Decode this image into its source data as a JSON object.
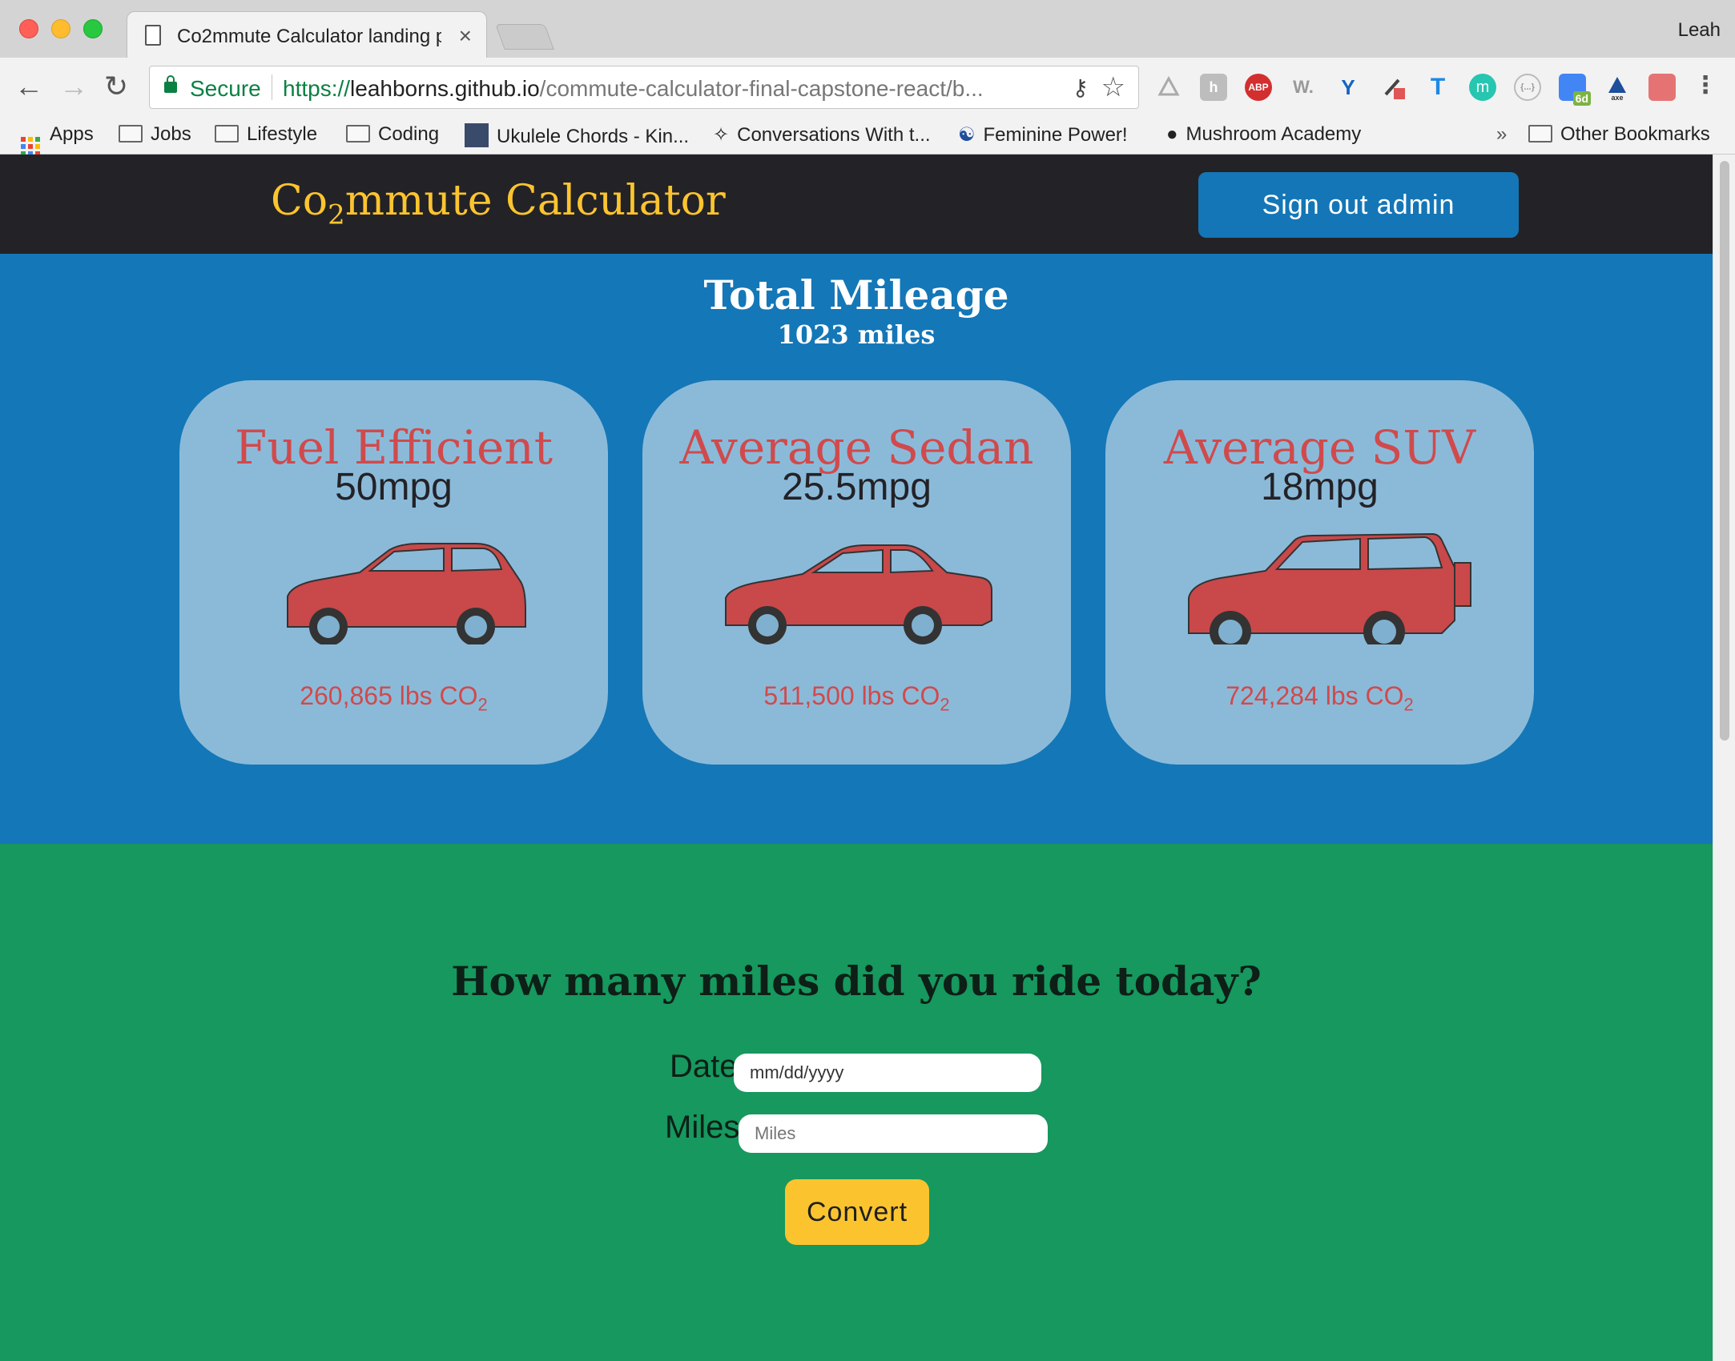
{
  "browser": {
    "tab_title": "Co2mmute Calculator landing p",
    "tab_close": "×",
    "profile_name": "Leah",
    "secure_label": "Secure",
    "url_protocol": "https://",
    "url_host": "leahborns.github.io",
    "url_path": "/commute-calculator-final-capstone-react/b...",
    "icons": {
      "back": "back-arrow-icon",
      "forward": "forward-arrow-icon",
      "reload": "reload-icon",
      "key": "key-icon",
      "star": "bookmark-star-icon"
    },
    "extensions": [
      "google-drive-icon",
      "hypothesis-icon",
      "adblock-icon",
      "wappalyzer-icon",
      "y-extension-icon",
      "eyedropper-icon",
      "t-extension-icon",
      "m-extension-icon",
      "json-viewer-icon",
      "calendar-6d-icon",
      "axe-icon",
      "extension-red-icon",
      "menu-dots-icon"
    ],
    "extension_labels": {
      "adblock": "ABP",
      "wappalyzer": "W.",
      "calendar": "6d",
      "axe": "axe",
      "m": "m",
      "json": "{...}"
    }
  },
  "bookmarks": {
    "items": [
      "Apps",
      "Jobs",
      "Lifestyle",
      "Coding",
      "Ukulele Chords - Kin...",
      "Conversations With t...",
      "Feminine Power!",
      "Mushroom Academy"
    ],
    "overflow": "»",
    "other": "Other Bookmarks"
  },
  "header": {
    "title_prefix": "Co",
    "title_sub": "2",
    "title_suffix": "mmute Calculator",
    "signout_label": "Sign out admin"
  },
  "mileage": {
    "title": "Total Mileage",
    "value": "1023 miles"
  },
  "cards": [
    {
      "title": "Fuel Efficient",
      "mpg": "50mpg",
      "co2_value": "260,865 lbs CO",
      "co2_sub": "2",
      "car": "hatchback-car-icon"
    },
    {
      "title": "Average Sedan",
      "mpg": "25.5mpg",
      "co2_value": "511,500 lbs CO",
      "co2_sub": "2",
      "car": "sedan-car-icon"
    },
    {
      "title": "Average SUV",
      "mpg": "18mpg",
      "co2_value": "724,284 lbs CO",
      "co2_sub": "2",
      "car": "suv-car-icon"
    }
  ],
  "form": {
    "title": "How many miles did you ride today?",
    "date_label": "Date",
    "date_value": "mm/dd/yyyy",
    "miles_label": "Miles",
    "miles_placeholder": "Miles",
    "convert_label": "Convert"
  },
  "colors": {
    "header_bg": "#232227",
    "accent_yellow": "#fbc42f",
    "primary_blue": "#1477b7",
    "card_bg": "#8bbad9",
    "card_red": "#d04a4c",
    "form_green": "#16985e"
  }
}
